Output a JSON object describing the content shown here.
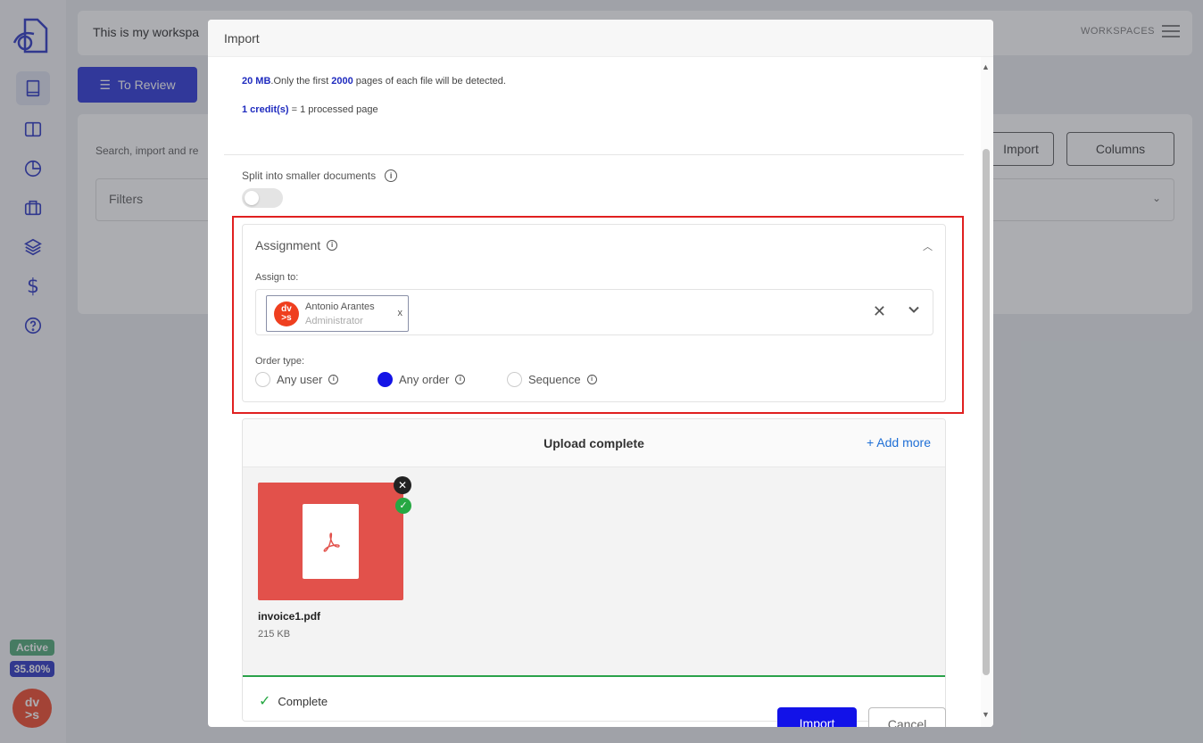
{
  "background": {
    "workspace_title": "This is my workspa",
    "workspaces_label": "WORKSPACES",
    "to_review_label": "To Review",
    "search_text": "Search, import and re",
    "import_label": "Import",
    "columns_label": "Columns",
    "filters_label": "Filters",
    "status_badge": "Active",
    "usage_percent": "35.80%",
    "avatar_initials": "dv\n>s"
  },
  "modal": {
    "title": "Import",
    "size_info": {
      "size_value": "20 MB",
      "text_a": ".Only the first ",
      "pages_value": "2000",
      "text_b": " pages of each file will be detected."
    },
    "credit_info": {
      "credit_value": "1 credit(s)",
      "text": " = 1 processed page"
    },
    "split_label": "Split into smaller documents",
    "split_enabled": false,
    "assignment": {
      "title": "Assignment",
      "assign_to_label": "Assign to:",
      "assignee": {
        "name": "Antonio Arantes",
        "role": "Administrator",
        "initials": "dv\n>s"
      },
      "order_type_label": "Order type:",
      "order_options": [
        {
          "label": "Any user",
          "selected": false
        },
        {
          "label": "Any order",
          "selected": true
        },
        {
          "label": "Sequence",
          "selected": false
        }
      ]
    },
    "upload": {
      "title": "Upload complete",
      "add_more_label": "Add more",
      "file": {
        "name": "invoice1.pdf",
        "size": "215 KB"
      },
      "status_label": "Complete"
    },
    "import_label": "Import",
    "cancel_label": "Cancel"
  },
  "colors": {
    "primary": "#1212e8",
    "highlight": "#e02020",
    "success": "#26a843",
    "file_thumb": "#e2514b"
  }
}
